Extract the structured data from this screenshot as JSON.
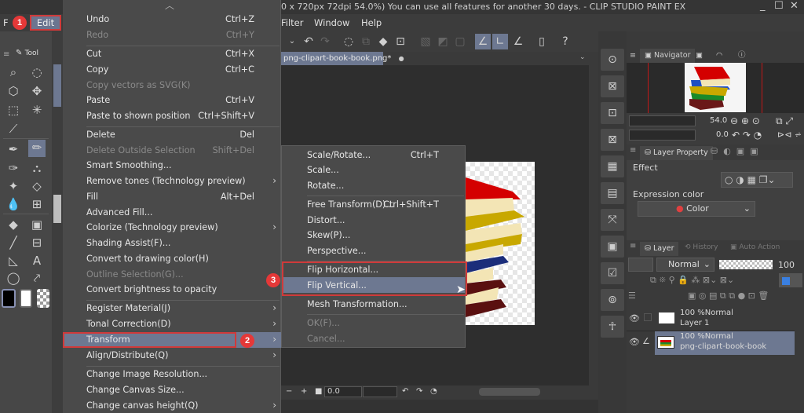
{
  "title_bar": {
    "text": "0 x 720px 72dpi 54.0%)  You can use all features for another 30 days. - CLIP STUDIO PAINT EX",
    "minimize": "_",
    "maximize": "☐",
    "close": "✕"
  },
  "menu_bar": {
    "file_partial": "F",
    "edit": "Edit",
    "filter_partial": "Filter",
    "window": "Window",
    "help": "Help"
  },
  "annotations": {
    "step1": "1",
    "step2": "2",
    "step3": "3"
  },
  "document_tab": {
    "label": "png-clipart-book-book.png*",
    "dot": "●"
  },
  "tool_panel": {
    "title": "Tool"
  },
  "edit_menu": {
    "scroll_up": "︿",
    "items": [
      {
        "label": "Undo",
        "shortcut": "Ctrl+Z",
        "disabled": false
      },
      {
        "label": "Redo",
        "shortcut": "Ctrl+Y",
        "disabled": true
      },
      {
        "label": "Cut",
        "shortcut": "Ctrl+X",
        "disabled": false
      },
      {
        "label": "Copy",
        "shortcut": "Ctrl+C",
        "disabled": false
      },
      {
        "label": "Copy vectors as SVG(K)",
        "shortcut": "",
        "disabled": true
      },
      {
        "label": "Paste",
        "shortcut": "Ctrl+V",
        "disabled": false
      },
      {
        "label": "Paste to shown position",
        "shortcut": "Ctrl+Shift+V",
        "disabled": false
      },
      {
        "label": "Delete",
        "shortcut": "Del",
        "disabled": false
      },
      {
        "label": "Delete Outside Selection",
        "shortcut": "Shift+Del",
        "disabled": true
      },
      {
        "label": "Smart Smoothing...",
        "shortcut": "",
        "disabled": false
      },
      {
        "label": "Remove tones (Technology preview)",
        "shortcut": "",
        "disabled": false,
        "submenu": true
      },
      {
        "label": "Fill",
        "shortcut": "Alt+Del",
        "disabled": false
      },
      {
        "label": "Advanced Fill...",
        "shortcut": "",
        "disabled": false
      },
      {
        "label": "Colorize (Technology preview)",
        "shortcut": "",
        "disabled": false,
        "submenu": true
      },
      {
        "label": "Shading Assist(F)...",
        "shortcut": "",
        "disabled": false
      },
      {
        "label": "Convert to drawing color(H)",
        "shortcut": "",
        "disabled": false
      },
      {
        "label": "Outline Selection(G)...",
        "shortcut": "",
        "disabled": true
      },
      {
        "label": "Convert brightness to opacity",
        "shortcut": "",
        "disabled": false
      },
      {
        "label": "Register Material(J)",
        "shortcut": "",
        "disabled": false,
        "submenu": true
      },
      {
        "label": "Tonal Correction(D)",
        "shortcut": "",
        "disabled": false,
        "submenu": true
      },
      {
        "label": "Transform",
        "shortcut": "",
        "disabled": false,
        "submenu": true,
        "highlighted": true
      },
      {
        "label": "Align/Distribute(Q)",
        "shortcut": "",
        "disabled": false,
        "submenu": true
      },
      {
        "label": "Change Image Resolution...",
        "shortcut": "",
        "disabled": false
      },
      {
        "label": "Change Canvas Size...",
        "shortcut": "",
        "disabled": false
      },
      {
        "label": "Change canvas height(Q)",
        "shortcut": "",
        "disabled": false,
        "submenu": true
      }
    ]
  },
  "transform_submenu": {
    "items": [
      {
        "label": "Scale/Rotate...",
        "shortcut": "Ctrl+T",
        "disabled": false
      },
      {
        "label": "Scale...",
        "shortcut": "",
        "disabled": false
      },
      {
        "label": "Rotate...",
        "shortcut": "",
        "disabled": false
      },
      {
        "label": "Free  Transform(D)...",
        "shortcut": "Ctrl+Shift+T",
        "disabled": false
      },
      {
        "label": "Distort...",
        "shortcut": "",
        "disabled": false
      },
      {
        "label": "Skew(P)...",
        "shortcut": "",
        "disabled": false
      },
      {
        "label": "Perspective...",
        "shortcut": "",
        "disabled": false
      },
      {
        "label": "Flip Horizontal...",
        "shortcut": "",
        "disabled": false
      },
      {
        "label": "Flip Vertical...",
        "shortcut": "",
        "disabled": false,
        "highlighted": true
      },
      {
        "label": "Mesh Transformation...",
        "shortcut": "",
        "disabled": false
      },
      {
        "label": "OK(F)...",
        "shortcut": "",
        "disabled": true
      },
      {
        "label": "Cancel...",
        "shortcut": "",
        "disabled": true
      }
    ]
  },
  "canvas_footer": {
    "rotation_value": "0.0"
  },
  "navigator": {
    "tab_label": "Navigator",
    "zoom_value": "54.0",
    "rotation_value": "0.0"
  },
  "layer_property": {
    "tab_label": "Layer Property",
    "effect_label": "Effect",
    "expression_color_label": "Expression color",
    "expression_color_value": "Color"
  },
  "layer_panel": {
    "tabs": [
      "Layer",
      "History",
      "Auto Action"
    ],
    "blend_mode": "Normal",
    "opacity": "100",
    "layers": [
      {
        "opacity_mode": "100 %Normal",
        "name": "Layer 1",
        "selected": false
      },
      {
        "opacity_mode": "100 %Normal",
        "name": "png-clipart-book-book",
        "selected": true
      }
    ]
  },
  "colors": {
    "highlight": "#6d7891",
    "annotation_red": "#e53838",
    "menu_bg": "#4a4a4a"
  }
}
